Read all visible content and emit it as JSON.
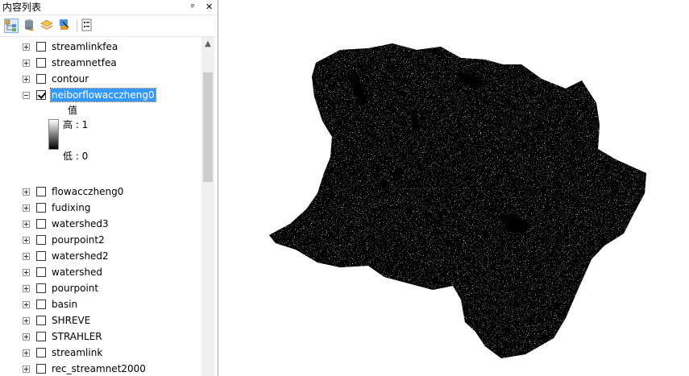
{
  "toc": {
    "title": "内容列表",
    "pin_glyph": "ᵖ",
    "close_glyph": "✕",
    "toolbar": [
      {
        "icon": "list-by-drawing-order-icon",
        "active": true
      },
      {
        "icon": "list-by-source-icon",
        "active": false
      },
      {
        "icon": "list-by-visibility-icon",
        "active": false
      },
      {
        "icon": "list-by-selection-icon",
        "active": false
      },
      {
        "icon": "options-icon",
        "active": false
      }
    ],
    "layers_top": [
      {
        "name": "streamlinkfea",
        "checked": false
      },
      {
        "name": "streamnetfea",
        "checked": false
      },
      {
        "name": "contour",
        "checked": false
      },
      {
        "name": "neiborflowacczheng0",
        "checked": true,
        "selected": true,
        "expanded": true
      }
    ],
    "legend": {
      "field": "值",
      "high": "高 : 1",
      "low": "低 : 0"
    },
    "layers_bottom": [
      {
        "name": "flowacczheng0",
        "checked": false
      },
      {
        "name": "fudixing",
        "checked": false
      },
      {
        "name": "watershed3",
        "checked": false
      },
      {
        "name": "pourpoint2",
        "checked": false
      },
      {
        "name": "watershed2",
        "checked": false
      },
      {
        "name": "watershed",
        "checked": false
      },
      {
        "name": "pourpoint",
        "checked": false
      },
      {
        "name": "basin",
        "checked": false
      },
      {
        "name": "SHREVE",
        "checked": false
      },
      {
        "name": "STRAHLER",
        "checked": false
      },
      {
        "name": "streamlink",
        "checked": false
      },
      {
        "name": "rec_streamnet2000",
        "checked": false
      }
    ],
    "scroll_up_glyph": "▲"
  },
  "map": {
    "layer_displayed": "neiborflowacczheng0"
  }
}
